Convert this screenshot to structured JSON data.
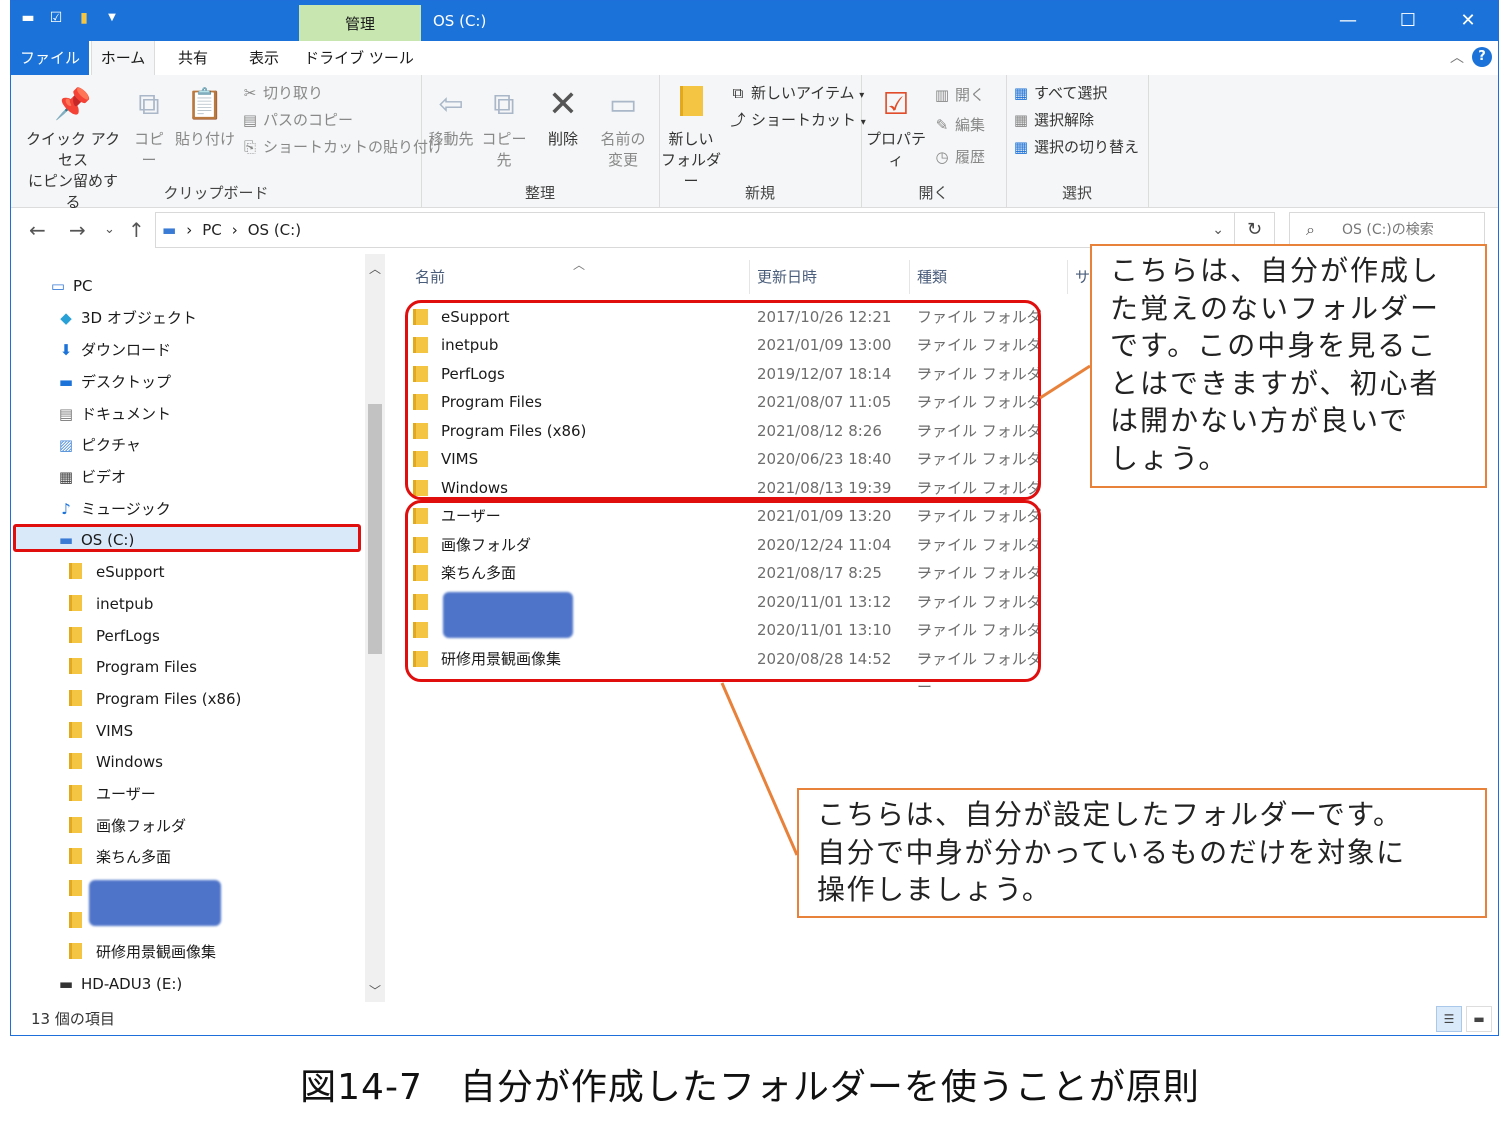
{
  "window": {
    "title": "OS (C:)",
    "manage_tab": "管理",
    "controls": {
      "minimize": "—",
      "maximize": "☐",
      "close": "✕"
    }
  },
  "tabs": {
    "file": "ファイル",
    "home": "ホーム",
    "share": "共有",
    "view": "表示",
    "drive_tools": "ドライブ ツール",
    "help": "?"
  },
  "ribbon": {
    "clipboard": {
      "label": "クリップボード",
      "pin_line1": "クイック アクセス",
      "pin_line2": "にピン留めする",
      "copy": "コピー",
      "paste": "貼り付け",
      "cut": "切り取り",
      "copy_path": "パスのコピー",
      "paste_shortcut": "ショートカットの貼り付け"
    },
    "organize": {
      "label": "整理",
      "move_to": "移動先",
      "copy_to": "コピー先",
      "delete": "削除",
      "rename_line1": "名前の",
      "rename_line2": "変更"
    },
    "new": {
      "label": "新規",
      "new_folder_line1": "新しい",
      "new_folder_line2": "フォルダー",
      "new_item": "新しいアイテム",
      "shortcut": "ショートカット"
    },
    "open": {
      "label": "開く",
      "properties": "プロパティ",
      "open": "開く",
      "edit": "編集",
      "history": "履歴"
    },
    "select": {
      "label": "選択",
      "select_all": "すべて選択",
      "select_none": "選択解除",
      "invert": "選択の切り替え"
    }
  },
  "address": {
    "crumbs": [
      "PC",
      "OS (C:)"
    ],
    "search_placeholder": "OS (C:)の検索"
  },
  "nav": {
    "items": [
      {
        "label": "PC",
        "icon": "pc-icon"
      },
      {
        "label": "3D オブジェクト",
        "icon": "cube-icon"
      },
      {
        "label": "ダウンロード",
        "icon": "download-icon"
      },
      {
        "label": "デスクトップ",
        "icon": "desktop-icon"
      },
      {
        "label": "ドキュメント",
        "icon": "document-icon"
      },
      {
        "label": "ピクチャ",
        "icon": "picture-icon"
      },
      {
        "label": "ビデオ",
        "icon": "video-icon"
      },
      {
        "label": "ミュージック",
        "icon": "music-icon"
      },
      {
        "label": "OS (C:)",
        "icon": "drive-icon"
      }
    ],
    "subfolders": [
      "eSupport",
      "inetpub",
      "PerfLogs",
      "Program Files",
      "Program Files (x86)",
      "VIMS",
      "Windows",
      "ユーザー",
      "画像フォルダ",
      "楽ちん多面",
      "",
      "",
      "研修用景観画像集"
    ],
    "external_drive": "HD-ADU3 (E:)"
  },
  "columns": {
    "name": "名前",
    "date": "更新日時",
    "type": "種類",
    "size": "サ"
  },
  "files": [
    {
      "name": "eSupport",
      "date": "2017/10/26 12:21",
      "type": "ファイル フォルダー"
    },
    {
      "name": "inetpub",
      "date": "2021/01/09 13:00",
      "type": "ファイル フォルダー"
    },
    {
      "name": "PerfLogs",
      "date": "2019/12/07 18:14",
      "type": "ファイル フォルダー"
    },
    {
      "name": "Program Files",
      "date": "2021/08/07 11:05",
      "type": "ファイル フォルダー"
    },
    {
      "name": "Program Files (x86)",
      "date": "2021/08/12 8:26",
      "type": "ファイル フォルダー"
    },
    {
      "name": "VIMS",
      "date": "2020/06/23 18:40",
      "type": "ファイル フォルダー"
    },
    {
      "name": "Windows",
      "date": "2021/08/13 19:39",
      "type": "ファイル フォルダー"
    },
    {
      "name": "ユーザー",
      "date": "2021/01/09 13:20",
      "type": "ファイル フォルダー"
    },
    {
      "name": "画像フォルダ",
      "date": "2020/12/24 11:04",
      "type": "ファイル フォルダー"
    },
    {
      "name": "楽ちん多面",
      "date": "2021/08/17 8:25",
      "type": "ファイル フォルダー"
    },
    {
      "name": "",
      "date": "2020/11/01 13:12",
      "type": "ファイル フォルダー"
    },
    {
      "name": "",
      "date": "2020/11/01 13:10",
      "type": "ファイル フォルダー"
    },
    {
      "name": "研修用景観画像集",
      "date": "2020/08/28 14:52",
      "type": "ファイル フォルダー"
    }
  ],
  "status": {
    "count": "13 個の項目"
  },
  "callouts": {
    "system": [
      "こちらは、自分が作成し",
      "た覚えのないフォルダー",
      "です。この中身を見るこ",
      "とはできますが、初心者",
      "は開かない方が良いで",
      "しょう。"
    ],
    "user": [
      "こちらは、自分が設定したフォルダーです。",
      "自分で中身が分かっているものだけを対象に",
      "操作しましょう。"
    ]
  },
  "caption": "図14-7　自分が作成したフォルダーを使うことが原則",
  "colors": {
    "accent": "#1b72d8",
    "highlight": "#e10e0e",
    "callout_border": "#e8813a",
    "manage_tab": "#c8e7b0"
  }
}
